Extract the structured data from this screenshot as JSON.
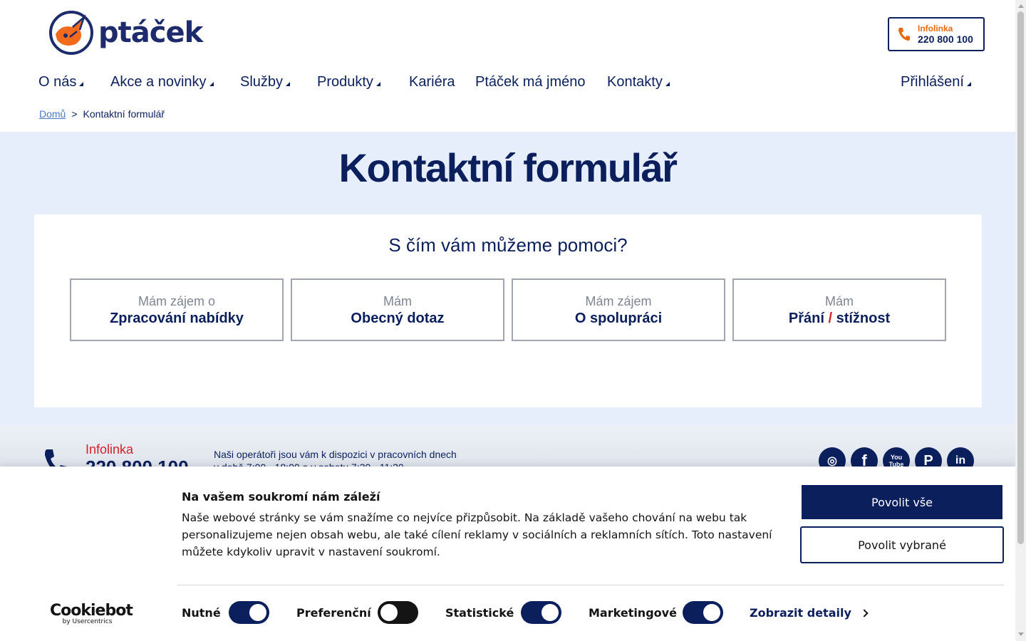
{
  "header": {
    "logo_text": "ptáček",
    "infolinka_label": "Infolinka",
    "infolinka_number": "220 800 100"
  },
  "nav": {
    "items": [
      {
        "label": "O nás",
        "has_dropdown": true
      },
      {
        "label": "Akce a novinky",
        "has_dropdown": true
      },
      {
        "label": "Služby",
        "has_dropdown": true
      },
      {
        "label": "Produkty",
        "has_dropdown": true
      },
      {
        "label": "Kariéra",
        "has_dropdown": false
      },
      {
        "label": "Ptáček má jméno",
        "has_dropdown": false
      },
      {
        "label": "Kontakty",
        "has_dropdown": true
      }
    ],
    "login": {
      "label": "Přihlášení",
      "has_dropdown": true
    }
  },
  "breadcrumb": {
    "home": "Domů",
    "separator": ">",
    "current": "Kontaktní formulář"
  },
  "main": {
    "title": "Kontaktní formulář",
    "question": "S čím vám můžeme pomoci?",
    "options": [
      {
        "small": "Mám zájem o",
        "big": "Zpracování nabídky"
      },
      {
        "small": "Mám",
        "big": "Obecný dotaz"
      },
      {
        "small": "Mám zájem",
        "big": "O spolupráci"
      },
      {
        "small": "Mám",
        "big_part1": "Přání",
        "big_sep": "/",
        "big_part2": "stížnost"
      }
    ]
  },
  "footer": {
    "infolinka_label": "Infolinka",
    "infolinka_number": "220 800 100",
    "hours_line1": "Naši operátoři jsou vám k dispozici v pracovních dnech",
    "hours_line2": "v době 7:00 - 18:00 a v sobotu 7:30 - 11:30",
    "social": [
      "instagram",
      "facebook",
      "youtube",
      "pinterest",
      "linkedin"
    ],
    "social_glyphs": {
      "instagram": "◎",
      "facebook": "f",
      "youtube": "You Tube",
      "pinterest": "P",
      "linkedin": "in"
    }
  },
  "cookie": {
    "title": "Na vašem soukromí nám záleží",
    "text": "Naše webové stránky se vám snažíme co nejvíce přizpůsobit. Na základě vašeho chování na webu tak personalizujeme nejen obsah webu, ale také cílení reklamy v sociálních a reklamních sítích. Toto nastavení můžete kdykoliv upravit v nastavení soukromí.",
    "allow_all": "Povolit vše",
    "allow_selected": "Povolit vybrané",
    "brand": "Cookiebot",
    "brand_sub": "by Usercentrics",
    "toggles": [
      {
        "label": "Nutné",
        "on": true
      },
      {
        "label": "Preferenční",
        "on": false
      },
      {
        "label": "Statistické",
        "on": true
      },
      {
        "label": "Marketingové",
        "on": true
      }
    ],
    "details": "Zobrazit detaily"
  },
  "colors": {
    "brand_navy": "#0b1f5c",
    "accent_orange": "#e86a10",
    "accent_red": "#d6202a",
    "hero_bg": "#e6edfb"
  }
}
